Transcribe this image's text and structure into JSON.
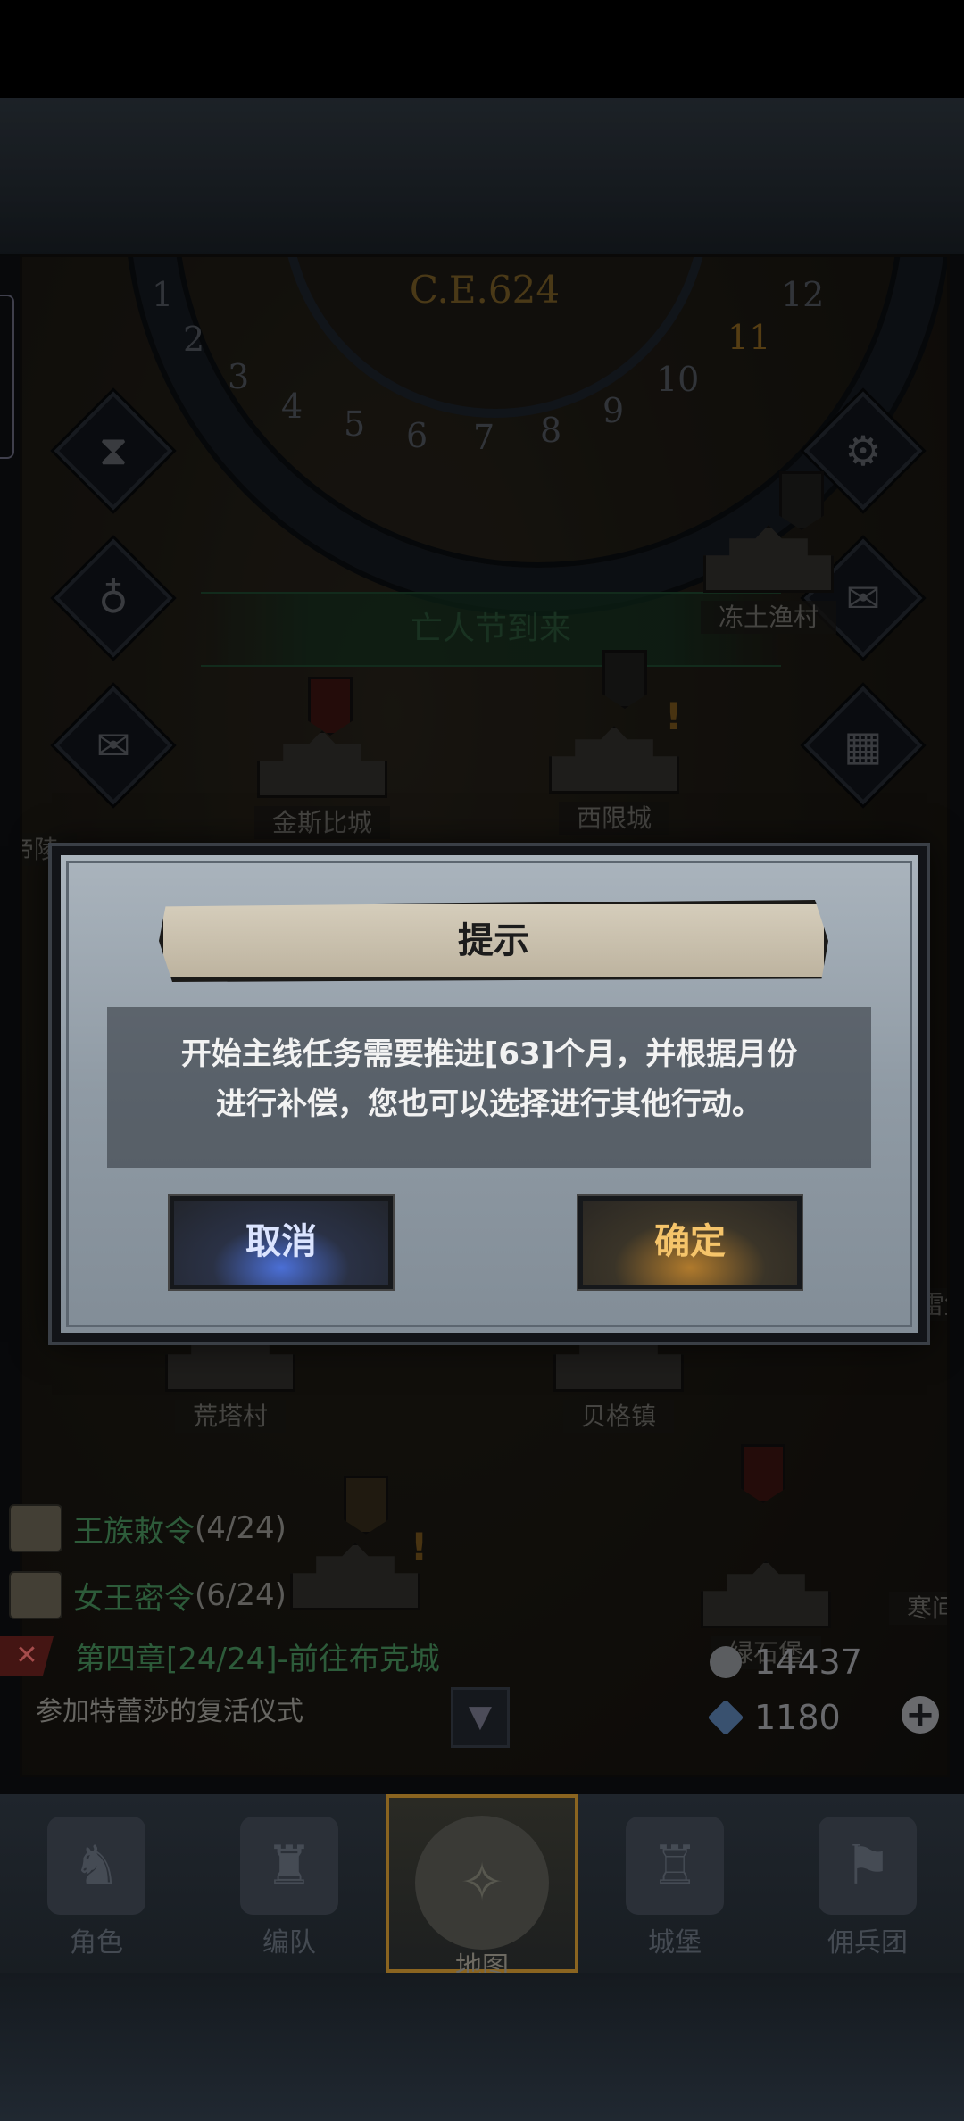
{
  "calendar": {
    "year": "C.E.624",
    "months": [
      "1",
      "2",
      "3",
      "4",
      "5",
      "6",
      "7",
      "8",
      "9",
      "10",
      "11",
      "12"
    ],
    "active_month": "11"
  },
  "event_banner": "亡人节到来",
  "places": [
    {
      "name": "冻土渔村"
    },
    {
      "name": "金斯比城"
    },
    {
      "name": "西限城"
    },
    {
      "name": "荒塔村"
    },
    {
      "name": "贝格镇"
    },
    {
      "name": "绿石堡"
    },
    {
      "name": "帝陵"
    },
    {
      "name": "寒间谷"
    },
    {
      "name": "雷堡"
    }
  ],
  "quests": [
    {
      "name": "王族敕令",
      "count": "(4/24)"
    },
    {
      "name": "女王密令",
      "count": "(6/24)"
    }
  ],
  "chapter": {
    "title": "第四章[24/24]-前往布克城",
    "subtitle": "参加特蕾莎的复活仪式"
  },
  "resources": {
    "silver": "14437",
    "gems": "1180"
  },
  "dialog": {
    "title": "提示",
    "line1": "开始主线任务需要推进[63]个月，并根据月份",
    "line2": "进行补偿，您也可以选择进行其他行动。",
    "cancel_label": "取消",
    "ok_label": "确定"
  },
  "nav": [
    {
      "label": "角色",
      "active": false
    },
    {
      "label": "编队",
      "active": false
    },
    {
      "label": "地图",
      "active": true
    },
    {
      "label": "城堡",
      "active": false
    },
    {
      "label": "佣兵团",
      "active": false
    }
  ],
  "colors": {
    "quest_green": "#3c7a4e",
    "cancel_glow": "#4b6fd6",
    "ok_glow": "#b07a2c",
    "active_nav_border": "#8a6420"
  }
}
